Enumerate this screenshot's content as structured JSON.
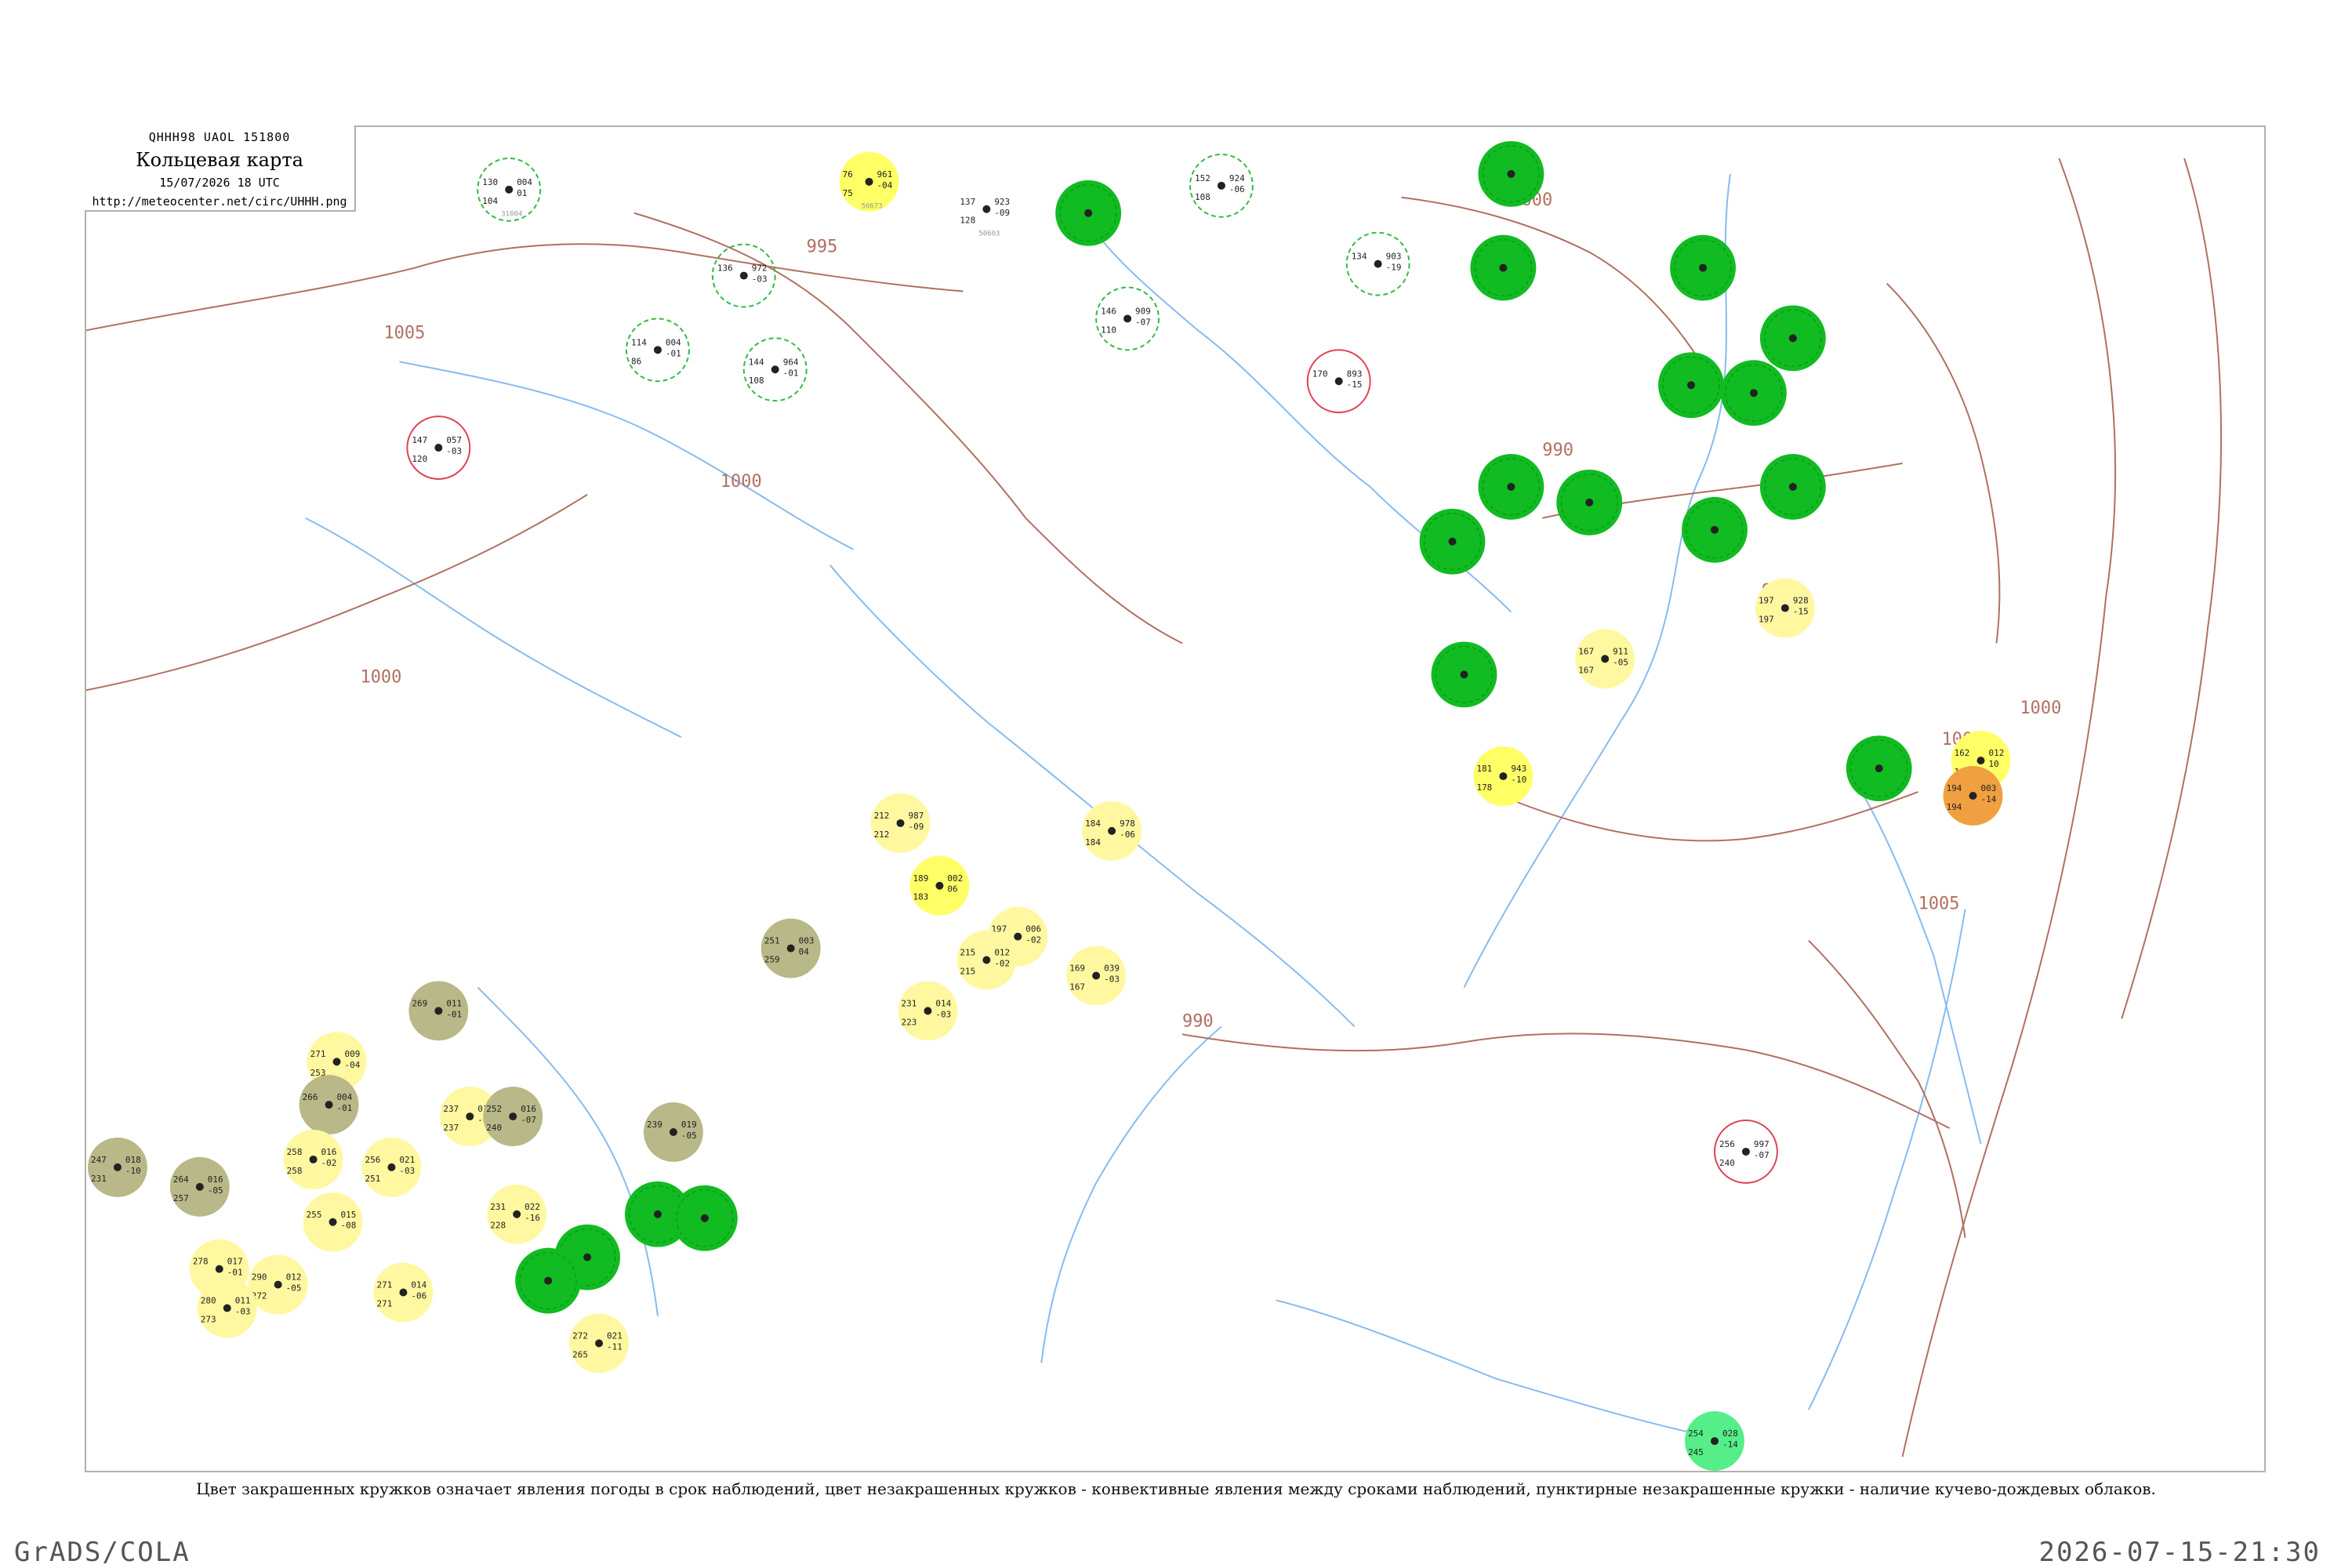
{
  "header": {
    "code": "QHHH98  UAOL  151800",
    "title": "Кольцевая карта",
    "date": "15/07/2026 18 UTC",
    "url": "http://meteocenter.net/circ/UHHH.png"
  },
  "caption": "Цвет закрашенных кружков означает явления погоды в срок наблюдений, цвет незакрашенных кружков - конвективные явления между сроками наблюдений, пунктирные незакрашенные кружки - наличие кучево-дождевых облаков.",
  "footer": {
    "left": "GrADS/COLA",
    "right": "2026-07-15-21:30"
  },
  "colors": {
    "green": "#11bb22",
    "yellow": "#ffff66",
    "pale_yellow": "#fff8a0",
    "olive": "#b8b888",
    "orange": "#f0a040",
    "bright_green": "#55ee88",
    "isobar": "#b07060",
    "river": "#88bbee",
    "ring_green": "#33bb44",
    "ring_red": "#dd4455"
  },
  "isobars": [
    {
      "label": "1005"
    },
    {
      "label": "995"
    },
    {
      "label": "1000"
    },
    {
      "label": "1000"
    },
    {
      "label": "990"
    },
    {
      "label": "990"
    },
    {
      "label": "1000"
    },
    {
      "label": "1000"
    },
    {
      "label": "1000"
    },
    {
      "label": "1005"
    },
    {
      "label": "990"
    }
  ],
  "stations": [
    {
      "t": "76",
      "d": "75",
      "p": "961",
      "tend": "-04",
      "idx": "50673",
      "fill": "yellow"
    },
    {
      "t": "130",
      "d": "104",
      "p": "004",
      "tend": "01",
      "idx": "31004",
      "fill": "none",
      "ring": "green-dash"
    },
    {
      "t": "152",
      "d": "108",
      "p": "924",
      "tend": "-06",
      "idx": "",
      "fill": "none",
      "ring": "green-dash"
    },
    {
      "t": "",
      "d": "",
      "p": "",
      "tend": "",
      "idx": "",
      "fill": "green"
    },
    {
      "t": "137",
      "d": "128",
      "p": "923",
      "tend": "-09",
      "idx": "50603",
      "fill": "none"
    },
    {
      "t": "",
      "d": "",
      "p": "",
      "tend": "",
      "idx": "",
      "fill": "green"
    },
    {
      "t": "146",
      "d": "110",
      "p": "909",
      "tend": "-07",
      "idx": "",
      "fill": "none",
      "ring": "green-dash"
    },
    {
      "t": "134",
      "d": "",
      "p": "903",
      "tend": "-19",
      "idx": "",
      "fill": "none",
      "ring": "green-dash"
    },
    {
      "t": "170",
      "d": "",
      "p": "893",
      "tend": "-15",
      "idx": "",
      "fill": "none",
      "ring": "red"
    },
    {
      "t": "147",
      "d": "120",
      "p": "057",
      "tend": "-03",
      "idx": "",
      "fill": "none",
      "ring": "red"
    },
    {
      "t": "114",
      "d": "86",
      "p": "004",
      "tend": "-01",
      "idx": "",
      "fill": "none",
      "ring": "green-dash"
    },
    {
      "t": "144",
      "d": "108",
      "p": "964",
      "tend": "-01",
      "idx": "",
      "fill": "none",
      "ring": "green-dash"
    },
    {
      "t": "136",
      "d": "",
      "p": "972",
      "tend": "-03",
      "idx": "",
      "fill": "none",
      "ring": "green-dash"
    },
    {
      "t": "",
      "d": "",
      "p": "",
      "tend": "",
      "idx": "",
      "fill": "green"
    },
    {
      "t": "",
      "d": "",
      "p": "",
      "tend": "",
      "idx": "",
      "fill": "green"
    },
    {
      "t": "",
      "d": "",
      "p": "",
      "tend": "",
      "idx": "",
      "fill": "green"
    },
    {
      "t": "",
      "d": "",
      "p": "",
      "tend": "",
      "idx": "",
      "fill": "green"
    },
    {
      "t": "",
      "d": "",
      "p": "",
      "tend": "",
      "idx": "",
      "fill": "green"
    },
    {
      "t": "",
      "d": "",
      "p": "",
      "tend": "",
      "idx": "",
      "fill": "green"
    },
    {
      "t": "",
      "d": "",
      "p": "",
      "tend": "",
      "idx": "",
      "fill": "green"
    },
    {
      "t": "",
      "d": "",
      "p": "",
      "tend": "",
      "idx": "",
      "fill": "green"
    },
    {
      "t": "",
      "d": "",
      "p": "",
      "tend": "",
      "idx": "",
      "fill": "green"
    },
    {
      "t": "",
      "d": "",
      "p": "",
      "tend": "",
      "idx": "",
      "fill": "green"
    },
    {
      "t": "197",
      "d": "197",
      "p": "928",
      "tend": "-15",
      "idx": "",
      "fill": "pale_yellow"
    },
    {
      "t": "167",
      "d": "167",
      "p": "911",
      "tend": "-05",
      "idx": "",
      "fill": "pale_yellow"
    },
    {
      "t": "",
      "d": "",
      "p": "",
      "tend": "",
      "idx": "",
      "fill": "green"
    },
    {
      "t": "181",
      "d": "178",
      "p": "943",
      "tend": "-10",
      "idx": "",
      "fill": "yellow"
    },
    {
      "t": "162",
      "d": "165",
      "p": "012",
      "tend": "10",
      "idx": "",
      "fill": "yellow"
    },
    {
      "t": "194",
      "d": "194",
      "p": "003",
      "tend": "-14",
      "idx": "",
      "fill": "orange"
    },
    {
      "t": "",
      "d": "",
      "p": "",
      "tend": "",
      "idx": "",
      "fill": "green"
    },
    {
      "t": "212",
      "d": "212",
      "p": "987",
      "tend": "-09",
      "idx": "",
      "fill": "pale_yellow"
    },
    {
      "t": "184",
      "d": "184",
      "p": "978",
      "tend": "-06",
      "idx": "",
      "fill": "pale_yellow"
    },
    {
      "t": "189",
      "d": "183",
      "p": "002",
      "tend": "06",
      "idx": "",
      "fill": "yellow"
    },
    {
      "t": "197",
      "d": "191",
      "p": "006",
      "tend": "-02",
      "idx": "",
      "fill": "pale_yellow"
    },
    {
      "t": "215",
      "d": "215",
      "p": "012",
      "tend": "-02",
      "idx": "",
      "fill": "pale_yellow"
    },
    {
      "t": "169",
      "d": "167",
      "p": "039",
      "tend": "-03",
      "idx": "",
      "fill": "pale_yellow"
    },
    {
      "t": "231",
      "d": "223",
      "p": "014",
      "tend": "-03",
      "idx": "",
      "fill": "pale_yellow"
    },
    {
      "t": "251",
      "d": "259",
      "p": "003",
      "tend": "04",
      "idx": "",
      "fill": "olive"
    },
    {
      "t": "269",
      "d": "",
      "p": "011",
      "tend": "-01",
      "idx": "",
      "fill": "olive"
    },
    {
      "t": "271",
      "d": "253",
      "p": "009",
      "tend": "-04",
      "idx": "",
      "fill": "pale_yellow"
    },
    {
      "t": "266",
      "d": "",
      "p": "004",
      "tend": "-01",
      "idx": "",
      "fill": "olive"
    },
    {
      "t": "237",
      "d": "237",
      "p": "017",
      "tend": "-02",
      "idx": "",
      "fill": "pale_yellow"
    },
    {
      "t": "252",
      "d": "240",
      "p": "016",
      "tend": "-07",
      "idx": "",
      "fill": "olive"
    },
    {
      "t": "239",
      "d": "",
      "p": "019",
      "tend": "-05",
      "idx": "",
      "fill": "olive"
    },
    {
      "t": "247",
      "d": "231",
      "p": "018",
      "tend": "-10",
      "idx": "",
      "fill": "olive"
    },
    {
      "t": "264",
      "d": "257",
      "p": "016",
      "tend": "-05",
      "idx": "",
      "fill": "olive"
    },
    {
      "t": "258",
      "d": "258",
      "p": "016",
      "tend": "-02",
      "idx": "",
      "fill": "pale_yellow"
    },
    {
      "t": "256",
      "d": "251",
      "p": "021",
      "tend": "-03",
      "idx": "",
      "fill": "pale_yellow"
    },
    {
      "t": "231",
      "d": "228",
      "p": "022",
      "tend": "-16",
      "idx": "",
      "fill": "pale_yellow"
    },
    {
      "t": "255",
      "d": "",
      "p": "015",
      "tend": "-08",
      "idx": "",
      "fill": "pale_yellow"
    },
    {
      "t": "",
      "d": "",
      "p": "",
      "tend": "",
      "idx": "",
      "fill": "green"
    },
    {
      "t": "",
      "d": "",
      "p": "",
      "tend": "",
      "idx": "",
      "fill": "green"
    },
    {
      "t": "",
      "d": "",
      "p": "",
      "tend": "",
      "idx": "",
      "fill": "green"
    },
    {
      "t": "",
      "d": "",
      "p": "",
      "tend": "",
      "idx": "",
      "fill": "green"
    },
    {
      "t": "278",
      "d": "",
      "p": "017",
      "tend": "-01",
      "idx": "",
      "fill": "pale_yellow"
    },
    {
      "t": "290",
      "d": "272",
      "p": "012",
      "tend": "-05",
      "idx": "",
      "fill": "pale_yellow"
    },
    {
      "t": "271",
      "d": "271",
      "p": "014",
      "tend": "-06",
      "idx": "",
      "fill": "pale_yellow"
    },
    {
      "t": "280",
      "d": "273",
      "p": "011",
      "tend": "-03",
      "idx": "",
      "fill": "pale_yellow"
    },
    {
      "t": "272",
      "d": "265",
      "p": "021",
      "tend": "-11",
      "idx": "",
      "fill": "pale_yellow"
    },
    {
      "t": "256",
      "d": "240",
      "p": "997",
      "tend": "-07",
      "idx": "",
      "fill": "none",
      "ring": "red"
    },
    {
      "t": "254",
      "d": "245",
      "p": "028",
      "tend": "-14",
      "idx": "",
      "fill": "bright_green"
    }
  ]
}
